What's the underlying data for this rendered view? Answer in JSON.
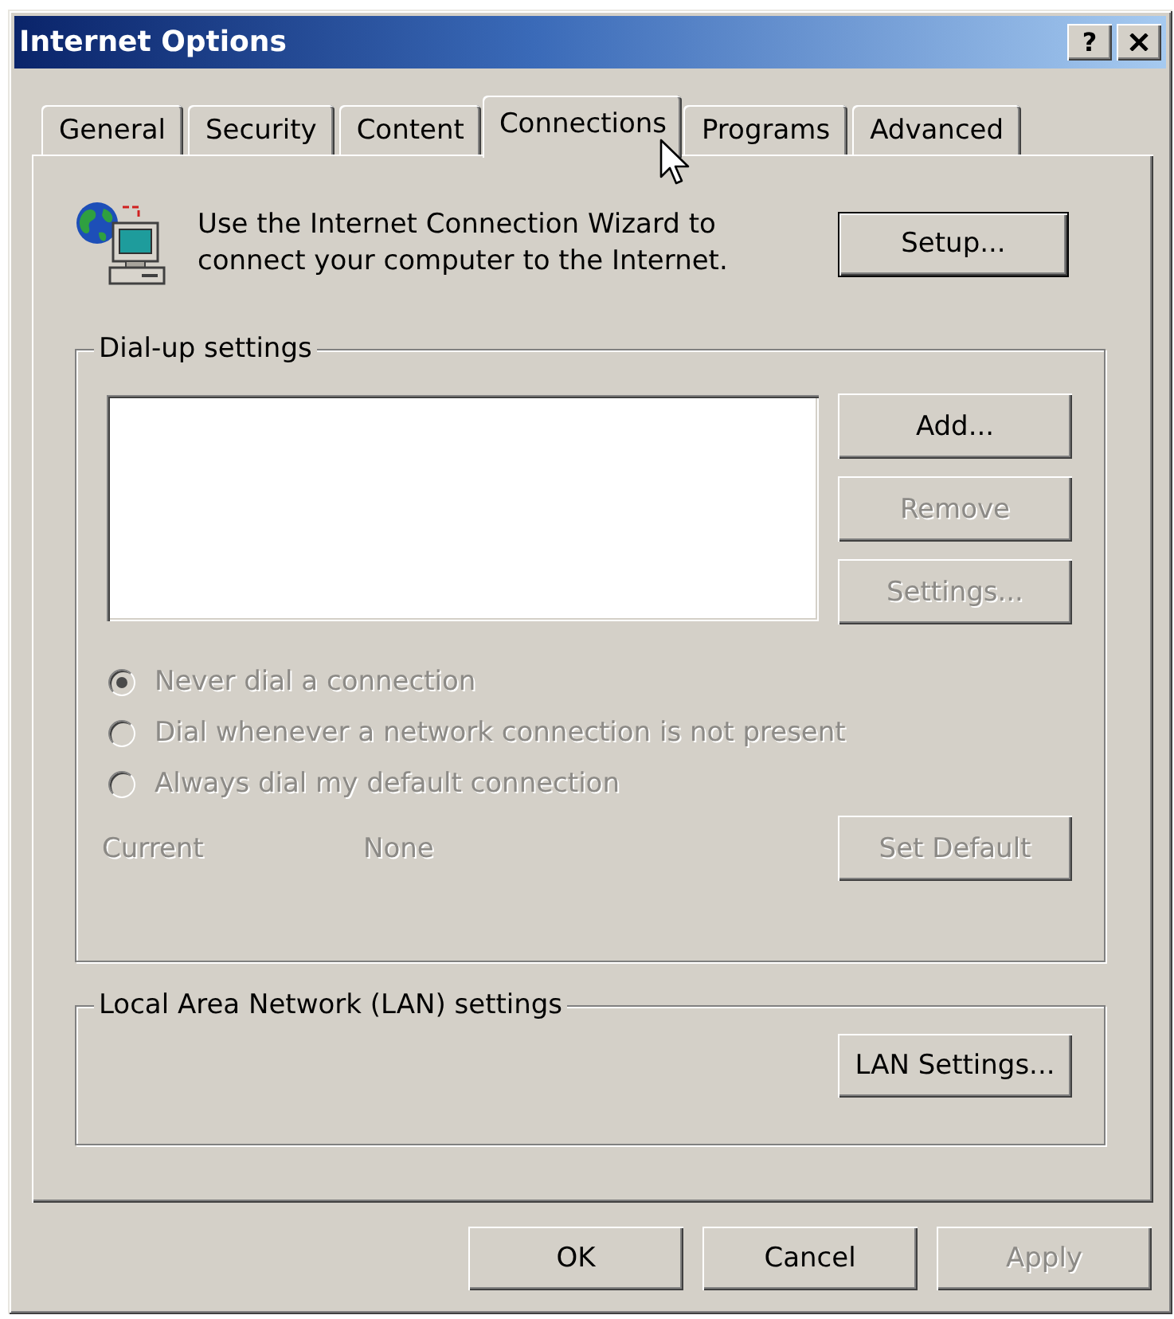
{
  "window": {
    "title": "Internet Options",
    "title_buttons": [
      {
        "kind": "help",
        "label": "?"
      },
      {
        "kind": "close"
      }
    ]
  },
  "tabs": [
    {
      "label": "General",
      "selected": false
    },
    {
      "label": "Security",
      "selected": false
    },
    {
      "label": "Content",
      "selected": false
    },
    {
      "label": "Connections",
      "selected": true
    },
    {
      "label": "Programs",
      "selected": false
    },
    {
      "label": "Advanced",
      "selected": false
    }
  ],
  "wizard": {
    "text": "Use the Internet Connection Wizard to\nconnect your computer to the Internet.",
    "button": {
      "label": "Setup...",
      "disabled": false,
      "default": true
    }
  },
  "dialup": {
    "title": "Dial-up settings",
    "buttons": [
      {
        "label": "Add...",
        "disabled": false
      },
      {
        "label": "Remove",
        "disabled": true
      },
      {
        "label": "Settings...",
        "disabled": true
      }
    ],
    "options": [
      {
        "label": "Never dial a connection",
        "selected": true,
        "disabled": true
      },
      {
        "label": "Dial whenever a network connection is not present",
        "selected": false,
        "disabled": true
      },
      {
        "label": "Always dial my default connection",
        "selected": false,
        "disabled": true
      }
    ],
    "current": {
      "label": "Current",
      "value": "None",
      "disabled": true
    },
    "set_default": {
      "label": "Set Default",
      "disabled": true
    }
  },
  "lan": {
    "title": "Local Area Network (LAN) settings",
    "button": {
      "label": "LAN Settings...",
      "disabled": false
    }
  },
  "footer_buttons": [
    {
      "label": "OK",
      "disabled": false
    },
    {
      "label": "Cancel",
      "disabled": false
    },
    {
      "label": "Apply",
      "disabled": true
    }
  ]
}
